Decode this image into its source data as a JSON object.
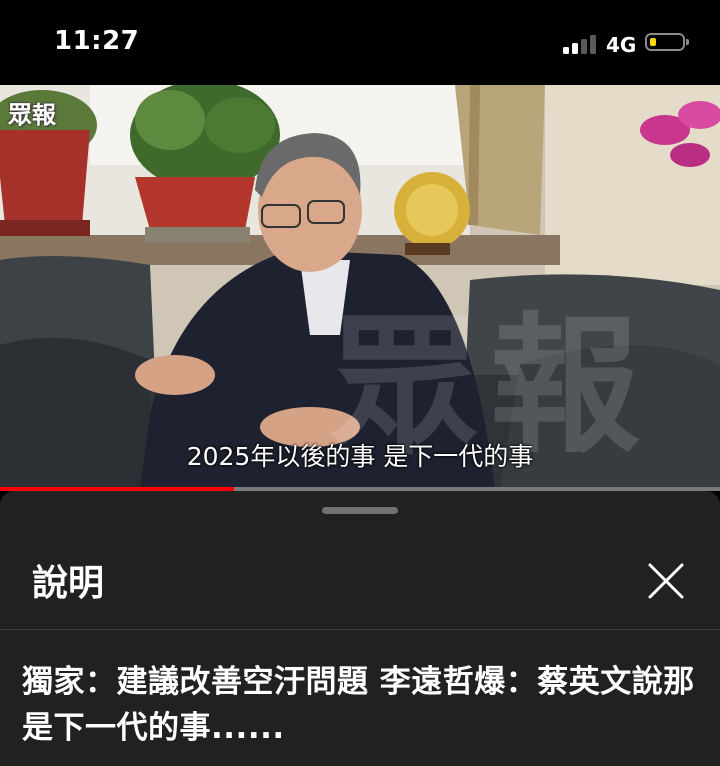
{
  "status_bar": {
    "time": "11:27",
    "network": "4G",
    "battery_color": "#ffd60a"
  },
  "video": {
    "watermark_logo": "眾報",
    "watermark_big": "眾報",
    "subtitle": "2025年以後的事 是下一代的事",
    "progress_fraction": 0.325,
    "progress_color": "#ff0000"
  },
  "sheet": {
    "title": "說明",
    "description": "獨家：建議改善空汙問題 李遠哲爆：蔡英文說那是下一代的事......"
  },
  "icons": {
    "close": "close-icon",
    "signal": "signal-icon",
    "battery": "battery-icon",
    "drag_handle": "drag-handle-icon"
  }
}
